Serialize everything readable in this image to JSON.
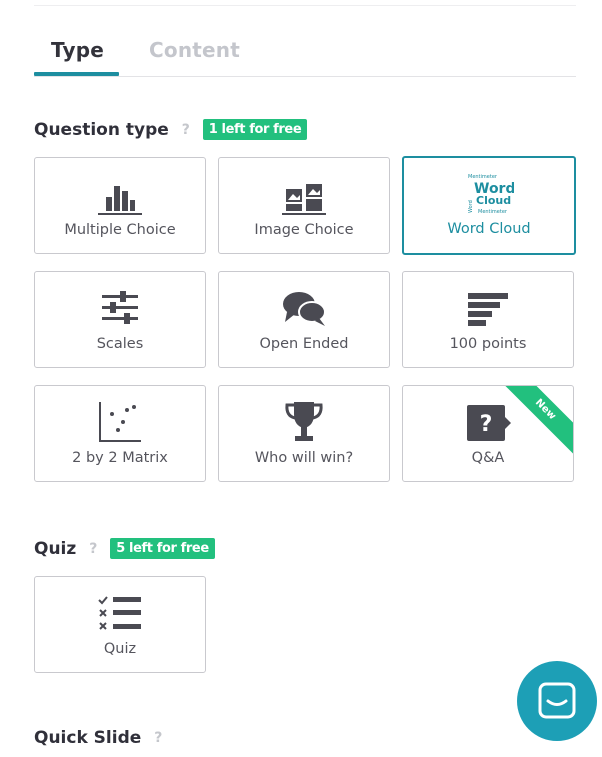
{
  "tabs": [
    {
      "label": "Type"
    },
    {
      "label": "Content"
    }
  ],
  "question_type": {
    "title": "Question type",
    "help": "?",
    "badge": "1 left for free",
    "cards": [
      {
        "label": "Multiple Choice",
        "icon": "bar-chart-icon"
      },
      {
        "label": "Image Choice",
        "icon": "image-choice-icon"
      },
      {
        "label": "Word Cloud",
        "icon": "word-cloud-icon",
        "selected": true
      },
      {
        "label": "Scales",
        "icon": "sliders-icon"
      },
      {
        "label": "Open Ended",
        "icon": "speech-bubbles-icon"
      },
      {
        "label": "100 points",
        "icon": "horizontal-bars-icon"
      },
      {
        "label": "2 by 2 Matrix",
        "icon": "scatter-matrix-icon"
      },
      {
        "label": "Who will win?",
        "icon": "trophy-icon"
      },
      {
        "label": "Q&A",
        "icon": "question-bubble-icon",
        "ribbon": "New"
      }
    ],
    "word_cloud_art": {
      "top": "Mentimeter",
      "big1": "Word",
      "big2": "Cloud",
      "side": "Word",
      "bottom": "Mentimeter"
    }
  },
  "quiz": {
    "title": "Quiz",
    "help": "?",
    "badge": "5 left for free",
    "cards": [
      {
        "label": "Quiz",
        "icon": "checklist-icon"
      }
    ]
  },
  "quick_slide": {
    "title": "Quick Slide",
    "help": "?"
  },
  "colors": {
    "accent": "#1d8ea0",
    "badge": "#22c07e",
    "icon": "#4a4a52",
    "chat": "#1d9fb6"
  },
  "chat": {
    "icon": "chat-icon"
  }
}
